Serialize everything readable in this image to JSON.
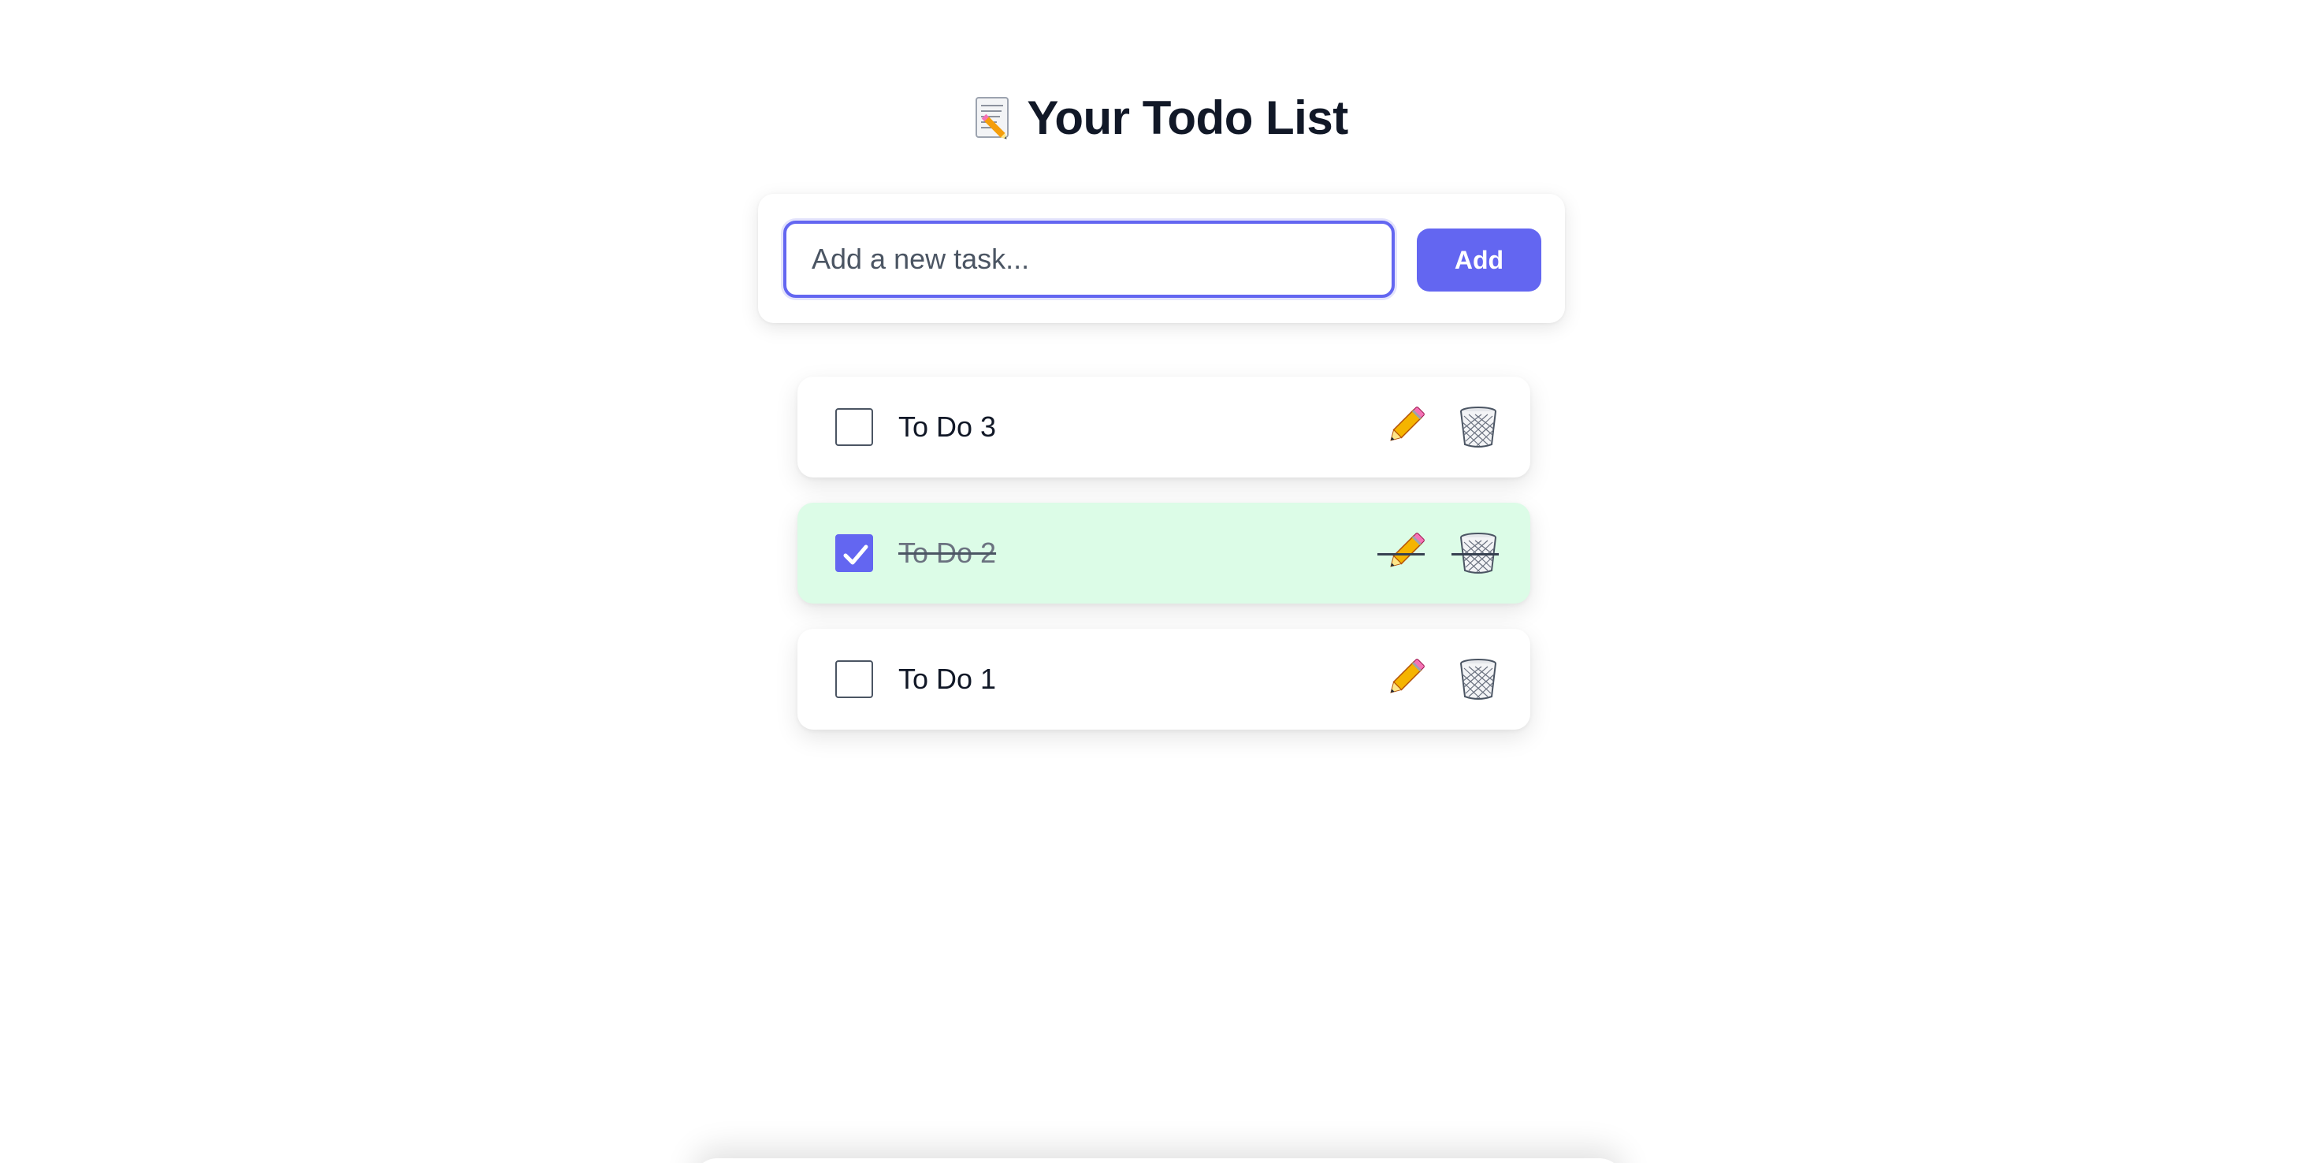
{
  "header": {
    "icon": "memo-icon",
    "title": "Your Todo List"
  },
  "form": {
    "input_value": "",
    "input_placeholder": "Add a new task...",
    "add_label": "Add"
  },
  "todos": [
    {
      "text": "To Do 3",
      "completed": false
    },
    {
      "text": "To Do 2",
      "completed": true
    },
    {
      "text": "To Do 1",
      "completed": false
    }
  ],
  "icons": {
    "edit": "pencil-icon",
    "delete": "wastebasket-icon"
  },
  "colors": {
    "accent": "#6366f1",
    "completed_bg": "#dcfce7",
    "text": "#111827"
  }
}
